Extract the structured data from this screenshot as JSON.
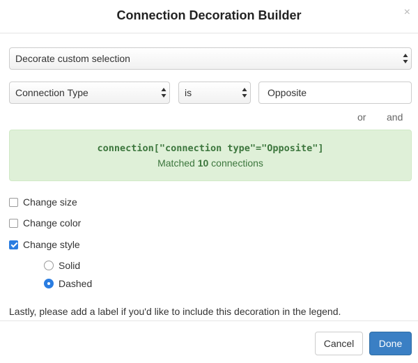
{
  "dialog": {
    "title": "Connection Decoration Builder",
    "close_glyph": "×"
  },
  "scope_select": {
    "value": "Decorate custom selection"
  },
  "filter": {
    "field_value": "Connection Type",
    "operator_value": "is",
    "input_value": "Opposite"
  },
  "logic_links": {
    "or_label": "or",
    "and_label": "and"
  },
  "match": {
    "query": "connection[\"connection type\"=\"Opposite\"]",
    "prefix": "Matched ",
    "count": "10",
    "suffix": " connections"
  },
  "options": {
    "change_size": {
      "label": "Change size",
      "checked": false
    },
    "change_color": {
      "label": "Change color",
      "checked": false
    },
    "change_style": {
      "label": "Change style",
      "checked": true
    }
  },
  "style_choices": {
    "solid": {
      "label": "Solid",
      "selected": false
    },
    "dashed": {
      "label": "Dashed",
      "selected": true
    }
  },
  "legend_note": "Lastly, please add a label if you'd like to include this decoration in the legend.",
  "footer": {
    "cancel_label": "Cancel",
    "done_label": "Done"
  },
  "colors": {
    "primary": "#3a7fc4",
    "success_bg": "#dff0d8",
    "success_text": "#3c763d",
    "checkbox_checked": "#2a7de1"
  }
}
